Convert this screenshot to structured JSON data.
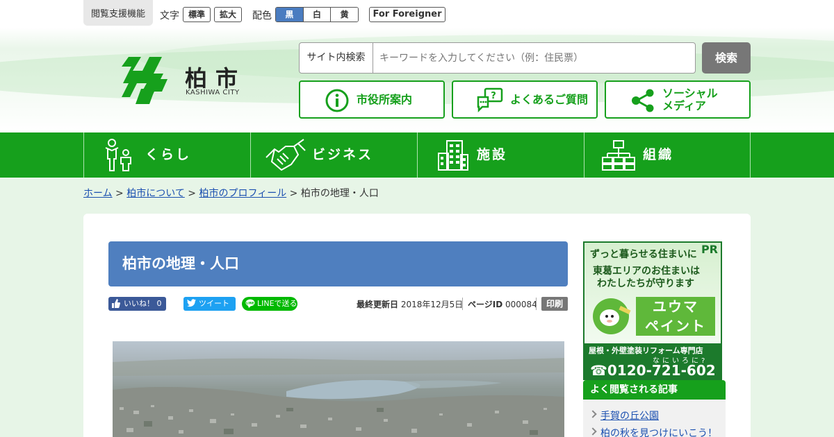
{
  "utility": {
    "title": "閲覧支援機能",
    "text_label": "文字",
    "text_standard": "標準",
    "text_large": "拡大",
    "color_label": "配色",
    "color_options": [
      "黒",
      "白",
      "黄"
    ],
    "foreigner": "For Foreigner"
  },
  "logo": {
    "name": "柏市",
    "subtitle": "KASHIWA CITY"
  },
  "search": {
    "label": "サイト内検索",
    "placeholder": "キーワードを入力してください（例：住民票）",
    "button": "検索"
  },
  "quick_links": [
    {
      "label": "市役所案内",
      "icon": "info-icon"
    },
    {
      "label": "よくあるご質問",
      "icon": "faq-icon"
    },
    {
      "label_line1": "ソーシャル",
      "label_line2": "メディア",
      "icon": "share-icon"
    }
  ],
  "global_nav": [
    {
      "label": "くらし",
      "icon": "family-icon"
    },
    {
      "label": "ビジネス",
      "icon": "handshake-icon"
    },
    {
      "label": "施設",
      "icon": "building-icon"
    },
    {
      "label": "組織",
      "icon": "org-chart-icon"
    }
  ],
  "breadcrumb": {
    "home": "ホーム",
    "level1": "柏市について",
    "level2": "柏市のプロフィール",
    "current": "柏市の地理・人口",
    "sep": ">"
  },
  "page": {
    "title": "柏市の地理・人口",
    "updated_label": "最終更新日",
    "updated_value": "2018年12月5日",
    "page_id_label": "ページID",
    "page_id_value": "000084",
    "print": "印刷"
  },
  "social": {
    "like": "いいね！ 0",
    "tweet": "ツイート",
    "line": "LINEで送る"
  },
  "ad": {
    "pr": "PR",
    "line1": "ずっと暮らせる住まいに",
    "line2": "東葛エリアのお住まいは",
    "line3": "わたしたちが守ります",
    "brand1": "ユウマ",
    "brand2": "ペイント",
    "line4": "屋根・外壁塗装リフォーム専門店",
    "ruby": "なにいろに?",
    "phone": "☎0120-721-602"
  },
  "popular": {
    "heading": "よく閲覧される記事",
    "items": [
      "手賀の丘公園",
      "柏の秋を見つけにいこう！"
    ]
  },
  "colors": {
    "brand_green": "#16a01c",
    "title_blue": "#4f7fbf",
    "facebook": "#3b5998",
    "twitter": "#1da1f2",
    "line": "#00b900"
  }
}
